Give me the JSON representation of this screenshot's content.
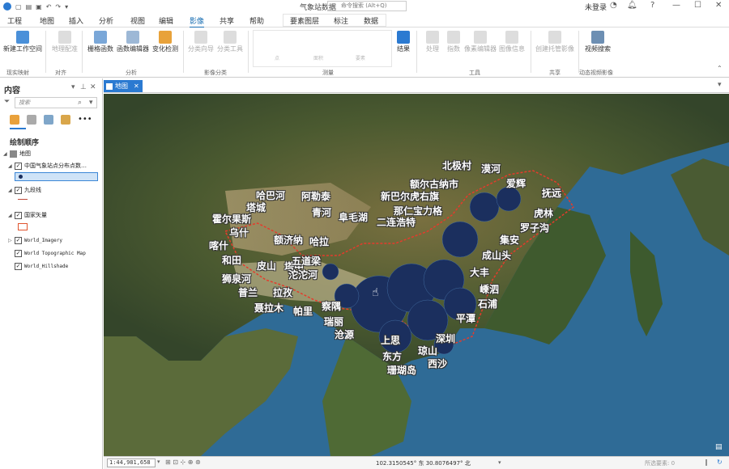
{
  "window": {
    "title": "气象站数据",
    "search_placeholder": "命令搜索 (Alt+Q)",
    "user": "未登录",
    "help": "?",
    "minimize": "—",
    "maximize": "☐",
    "close": "✕"
  },
  "menus": [
    "工程",
    "地图",
    "插入",
    "分析",
    "视图",
    "编辑",
    "影像",
    "共享",
    "帮助"
  ],
  "context_menus": [
    "要素图层",
    "标注",
    "数据"
  ],
  "active_menu": "影像",
  "ribbon": {
    "buttons": [
      {
        "label": "新建工作空间",
        "enabled": true
      },
      {
        "label": "地理配准",
        "enabled": false
      },
      {
        "label": "栅格函数",
        "enabled": true
      },
      {
        "label": "函数编辑器",
        "enabled": true
      },
      {
        "label": "变化检测",
        "enabled": true
      },
      {
        "label": "分类向导",
        "enabled": false
      },
      {
        "label": "分类工具",
        "enabled": false
      },
      {
        "label": "结果",
        "enabled": true
      },
      {
        "label": "处理",
        "enabled": false
      },
      {
        "label": "指数",
        "enabled": false
      },
      {
        "label": "像素编辑器",
        "enabled": false
      },
      {
        "label": "图像信息",
        "enabled": false
      },
      {
        "label": "创建托管影像",
        "enabled": false
      },
      {
        "label": "视频搜索",
        "enabled": true
      }
    ],
    "measure_items": [
      "点",
      "面积",
      "要素"
    ],
    "groups": [
      "现实映射",
      "对齐",
      "分析",
      "影像分类",
      "测量",
      "工具",
      "共享",
      "动态视频影像"
    ]
  },
  "contents": {
    "title": "内容",
    "search_placeholder": "搜索",
    "drawing_order": "绘制顺序",
    "layers": [
      {
        "label": "地图",
        "checked": null
      },
      {
        "label": "中国气象站点分布点数…",
        "checked": true
      },
      {
        "label": "九段线",
        "checked": true
      },
      {
        "label": "国家矢量",
        "checked": true
      },
      {
        "label": "World_Imagery",
        "checked": true
      },
      {
        "label": "World Topographic Map",
        "checked": true
      },
      {
        "label": "World_Hillshade",
        "checked": true
      }
    ]
  },
  "map_tab": {
    "label": "地图",
    "close": "✕"
  },
  "map_labels": [
    "北极村",
    "漠河",
    "额尔古纳市",
    "爱辉",
    "抚远",
    "哈巴河",
    "阿勒泰",
    "塔城",
    "新巴尔虎右旗",
    "霍尔果斯",
    "青河",
    "阜毛湖",
    "那仁宝力格",
    "虎林",
    "二连浩特",
    "罗子沟",
    "乌什",
    "喀什",
    "额济纳",
    "集安",
    "哈拉",
    "和田",
    "皮山",
    "塔中",
    "五道梁",
    "成山头",
    "狮泉河",
    "沱沱河",
    "大丰",
    "普兰",
    "拉孜",
    "嵊泗",
    "石浦",
    "聂拉木",
    "帕里",
    "察隅",
    "平潭",
    "瑞丽",
    "沧源",
    "深圳",
    "上思",
    "东方",
    "琼山",
    "西沙",
    "珊瑚岛"
  ],
  "status": {
    "scale": "1:44,981,658",
    "coords": "102.3150545° 东 30.8076497° 北",
    "new_features": "所选要素: 0"
  },
  "colors": {
    "accent": "#2b7ad1",
    "station_dot": "#1b2f5e",
    "border": "#e53b2c"
  }
}
